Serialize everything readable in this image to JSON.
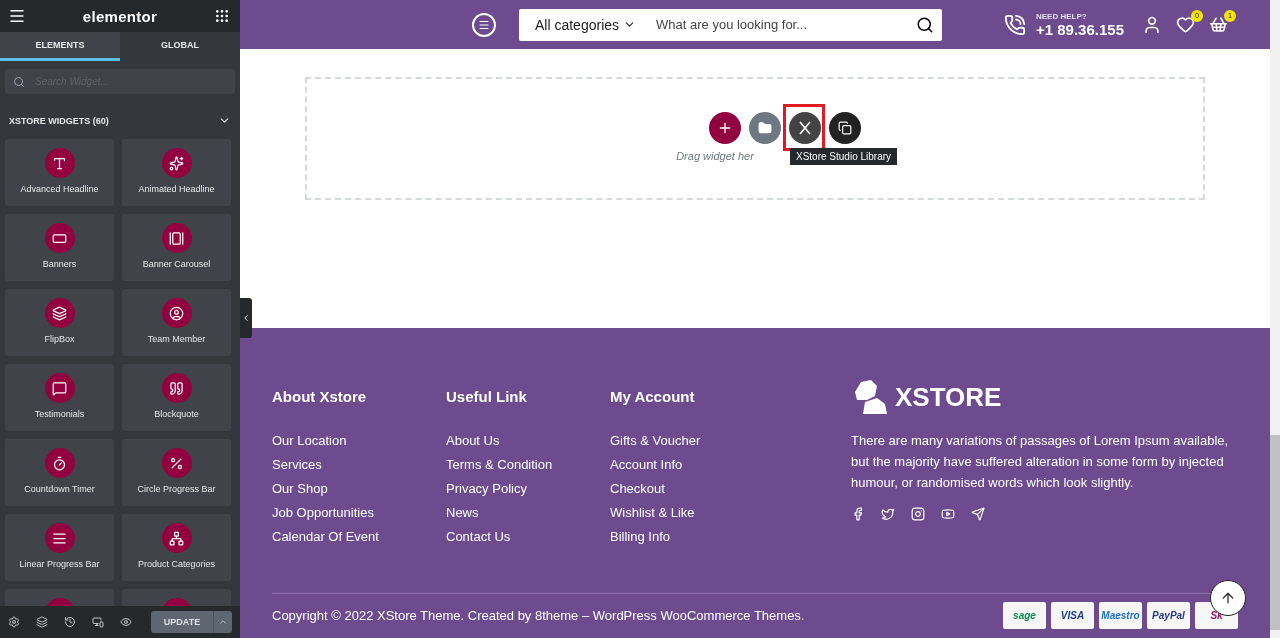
{
  "editor": {
    "logo": "elementor",
    "tabs": [
      {
        "label": "ELEMENTS",
        "selected": true
      },
      {
        "label": "GLOBAL",
        "selected": false
      }
    ],
    "search": {
      "placeholder": "Search Widget..."
    },
    "category": {
      "title": "XSTORE WIDGETS (60)",
      "expanded": true
    },
    "widgets": [
      {
        "label": "Advanced Headline"
      },
      {
        "label": "Animated Headline"
      },
      {
        "label": "Banners"
      },
      {
        "label": "Banner Carousel"
      },
      {
        "label": "FlipBox"
      },
      {
        "label": "Team Member"
      },
      {
        "label": "Testimonials"
      },
      {
        "label": "Blockquote"
      },
      {
        "label": "Countdown Timer"
      },
      {
        "label": "Circle Progress Bar"
      },
      {
        "label": "Linear Progress Bar"
      },
      {
        "label": "Product Categories"
      }
    ],
    "update_button": "UPDATE"
  },
  "header": {
    "search": {
      "category": "All categories",
      "placeholder": "What are you looking for..."
    },
    "help": {
      "label": "NEED HELP?",
      "phone": "+1 89.36.155"
    },
    "wishlist_count": "0",
    "cart_count": "1"
  },
  "canvas": {
    "hint": "Drag widget her",
    "tooltip": "XStore Studio Library"
  },
  "footer": {
    "columns": [
      {
        "title": "About Xstore",
        "links": [
          "Our Location",
          "Services",
          "Our Shop",
          "Job Opportunities",
          "Calendar Of Event"
        ]
      },
      {
        "title": "Useful Link",
        "links": [
          "About Us",
          "Terms & Condition",
          "Privacy Policy",
          "News",
          "Contact Us"
        ]
      },
      {
        "title": "My Account",
        "links": [
          "Gifts & Voucher",
          "Account Info",
          "Checkout",
          "Wishlist & Like",
          "Billing Info"
        ]
      }
    ],
    "brand": {
      "name": "XSTORE",
      "text": "There are many variations of passages of Lorem Ipsum available, but the majority have suffered alteration in some form by injected humour, or randomised words which look slightly."
    },
    "copyright": "Copyright © 2022 XStore Theme. Created by 8theme – WordPress WooCommerce Themes.",
    "payments": [
      "sage",
      "VISA",
      "Maestro",
      "PayPal",
      "Sk"
    ]
  }
}
